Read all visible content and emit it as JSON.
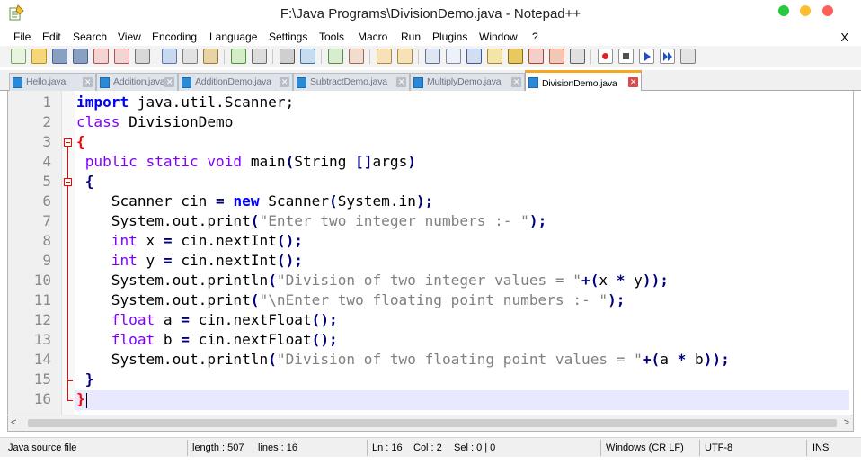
{
  "window": {
    "title": "F:\\Java Programs\\DivisionDemo.java - Notepad++"
  },
  "menu": {
    "items": [
      "File",
      "Edit",
      "Search",
      "View",
      "Encoding",
      "Language",
      "Settings",
      "Tools",
      "Macro",
      "Run",
      "Plugins",
      "Window",
      "?"
    ],
    "close_label": "X"
  },
  "toolbar": {
    "icons": [
      "new-file-icon",
      "open-file-icon",
      "save-icon",
      "save-all-icon",
      "close-icon",
      "close-all-icon",
      "print-icon",
      "cut-icon",
      "copy-icon",
      "paste-icon",
      "undo-icon",
      "redo-icon",
      "find-icon",
      "replace-icon",
      "zoom-in-icon",
      "zoom-out-icon",
      "sync-v-icon",
      "sync-h-icon",
      "word-wrap-icon",
      "all-chars-icon",
      "indent-guide-icon",
      "udl-icon",
      "doc-map-icon",
      "function-list-icon",
      "folder-workspace-icon",
      "monitor-icon",
      "record-macro-icon",
      "stop-macro-icon",
      "play-macro-icon",
      "run-macro-multiple-icon",
      "save-macro-icon"
    ]
  },
  "tabs": [
    {
      "label": "Hello.java",
      "active": false
    },
    {
      "label": "Addition.java",
      "active": false
    },
    {
      "label": "AdditionDemo.java",
      "active": false
    },
    {
      "label": "SubtractDemo.java",
      "active": false
    },
    {
      "label": "MultiplyDemo.java",
      "active": false
    },
    {
      "label": "DivisionDemo.java",
      "active": true
    }
  ],
  "editor": {
    "line_numbers": [
      "1",
      "2",
      "3",
      "4",
      "5",
      "6",
      "7",
      "8",
      "9",
      "10",
      "11",
      "12",
      "13",
      "14",
      "15",
      "16"
    ],
    "lines": [
      "import java.util.Scanner;",
      "class DivisionDemo",
      "{",
      " public static void main(String []args)",
      " {",
      "    Scanner cin = new Scanner(System.in);",
      "    System.out.print(\"Enter two integer numbers :- \");",
      "    int x = cin.nextInt();",
      "    int y = cin.nextInt();",
      "    System.out.println(\"Division of two integer values = \"+(x * y));",
      "    System.out.print(\"\\nEnter two floating point numbers :- \");",
      "    float a = cin.nextFloat();",
      "    float b = cin.nextFloat();",
      "    System.out.println(\"Division of two floating point values = \"+(a * b));",
      " }",
      "}"
    ]
  },
  "status": {
    "file_type": "Java source file",
    "length": "length : 507",
    "lines": "lines : 16",
    "ln": "Ln : 16",
    "col": "Col : 2",
    "sel": "Sel : 0 | 0",
    "eol": "Windows (CR LF)",
    "encoding": "UTF-8",
    "mode": "INS"
  },
  "colors": {
    "keyword": "#0000ff",
    "type": "#8000ff",
    "string": "#808080",
    "brace": "#ff0000",
    "active_tab_accent": "#f5a623",
    "current_line": "#e8e8ff"
  }
}
